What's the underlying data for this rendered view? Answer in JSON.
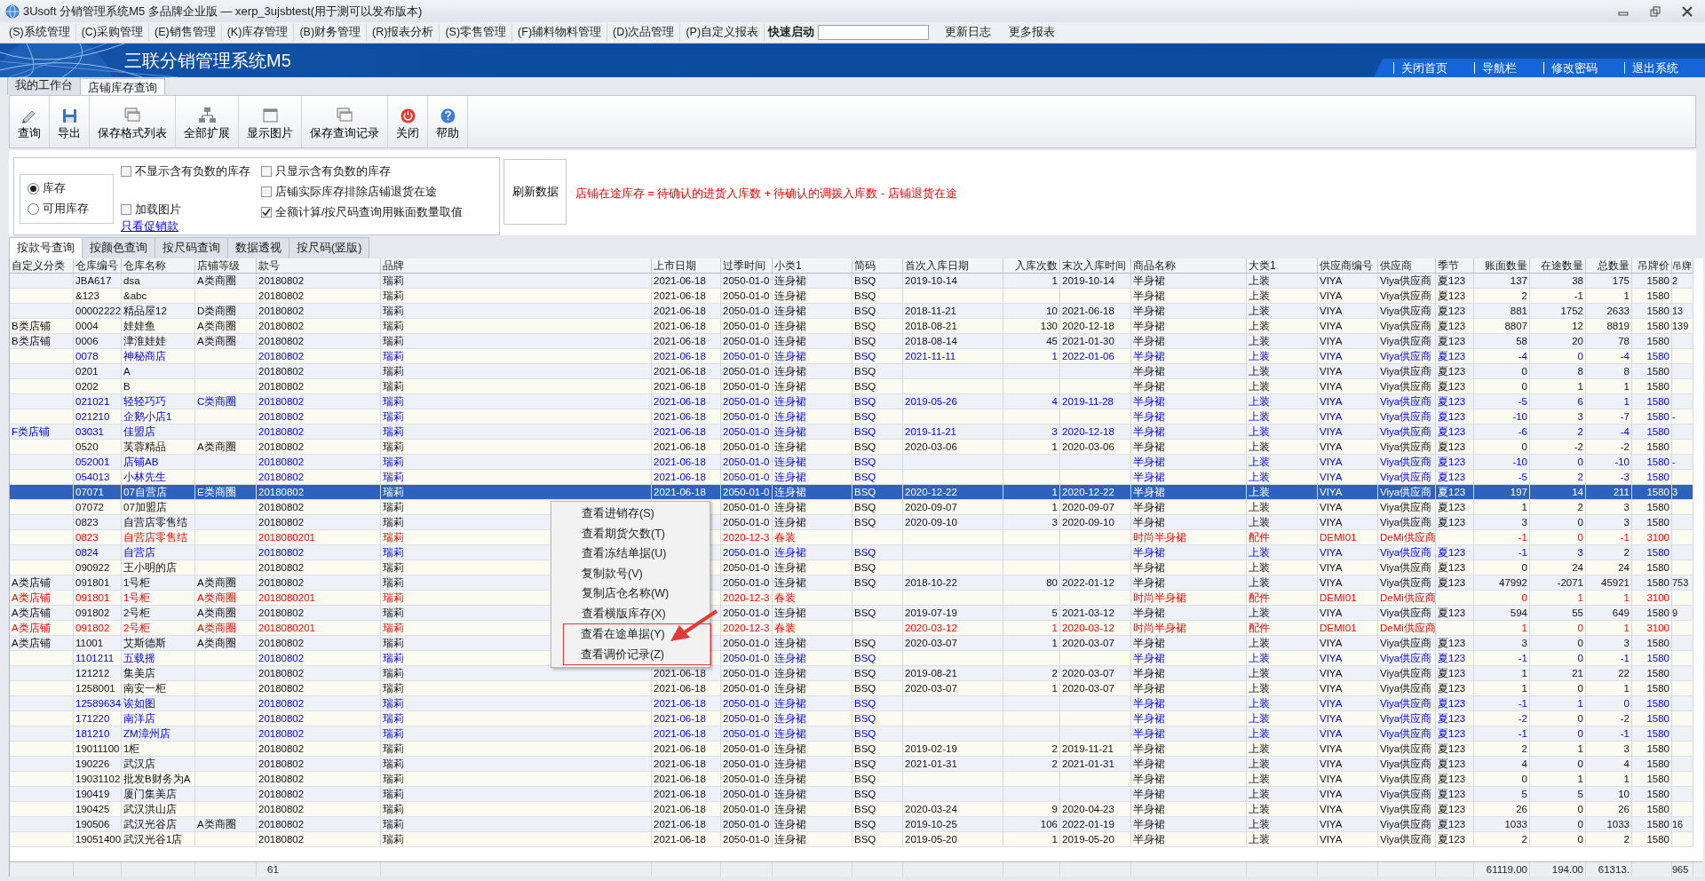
{
  "window": {
    "title": "3Usoft 分销管理系统M5 多品牌企业版 — xerp_3ujsbtest(用于测可以发布版本)"
  },
  "menu_bar": {
    "items": [
      "(S)系统管理",
      "(C)采购管理",
      "(E)销售管理",
      "(K)库存管理",
      "(B)财务管理",
      "(R)报表分析",
      "(S)零售管理",
      "(F)辅料物料管理",
      "(D)次品管理",
      "(P)自定义报表"
    ],
    "quick_launch": {
      "label": "快速启动"
    },
    "links": [
      "更新日志",
      "更多报表"
    ]
  },
  "banner": {
    "title": "三联分销管理系统M5",
    "links": [
      "关闭首页",
      "导航栏",
      "修改密码",
      "退出系统"
    ]
  },
  "tabs": [
    {
      "label": "我的工作台",
      "selected": false
    },
    {
      "label": "店铺库存查询",
      "selected": true
    }
  ],
  "toolbar": [
    {
      "label": "查询",
      "kind": "query"
    },
    {
      "label": "导出",
      "kind": "export"
    },
    {
      "label": "保存格式列表",
      "kind": "stack"
    },
    {
      "label": "全部扩展",
      "kind": "tree"
    },
    {
      "label": "显示图片",
      "kind": "window"
    },
    {
      "label": "保存查询记录",
      "kind": "stack"
    },
    {
      "label": "关闭",
      "kind": "close"
    },
    {
      "label": "帮助",
      "kind": "help"
    }
  ],
  "filters": {
    "stock_mode": [
      {
        "label": "库存",
        "selected": true
      },
      {
        "label": "可用库存",
        "selected": false
      }
    ],
    "checkbox_columns": [
      [
        {
          "label": "不显示含有负数的库存",
          "checked": false
        },
        {
          "label": "加载图片",
          "checked": false
        }
      ],
      [
        {
          "label": "只显示含有负数的库存",
          "checked": false
        },
        {
          "label": "店铺实际库存排除店铺退货在途",
          "checked": false
        },
        {
          "label": "全额计算/按尺码查询用账面数量取值",
          "checked": true
        }
      ]
    ],
    "link": "只看促销款",
    "refresh_button": "刷新数据",
    "note": "店铺在途库存 = 待确认的进货入库数 + 待确认的调拨入库数 - 店铺退货在途"
  },
  "query_tabs": [
    {
      "label": "按款号查询",
      "selected": true
    },
    {
      "label": "按颜色查询",
      "selected": false
    },
    {
      "label": "按尺码查询",
      "selected": false
    },
    {
      "label": "数据透视",
      "selected": false
    },
    {
      "label": "按尺码(竖版)",
      "selected": false
    }
  ],
  "table": {
    "columns": [
      "自定义分类",
      "仓库编号",
      "仓库名称",
      "店铺等级",
      "款号",
      "品牌",
      "上市日期",
      "过季时间",
      "小类1",
      "简码",
      "首次入库日期",
      "入库次数",
      "末次入库时间",
      "商品名称",
      "大类1",
      "供应商编号",
      "供应商",
      "季节",
      "账面数量",
      "在途数量",
      "总数量",
      "吊牌价",
      "吊牌"
    ],
    "rows": [
      {
        "kind": "plain",
        "selected": false,
        "cells": [
          null,
          "JBA617",
          "dsa",
          "A类商圈",
          "20180802",
          "瑞莉",
          "2021-06-18",
          "2050-01-0",
          "连身裙",
          "BSQ",
          "2019-10-14",
          "1",
          "2019-10-14",
          "半身裙",
          "上装",
          "VIYA",
          "Viya供应商",
          "夏123",
          "137",
          "38",
          "175",
          "1580",
          "2"
        ]
      },
      {
        "kind": "plain",
        "selected": false,
        "cells": [
          null,
          "&123",
          "&abc",
          null,
          "20180802",
          "瑞莉",
          "2021-06-18",
          "2050-01-0",
          "连身裙",
          "BSQ",
          null,
          null,
          null,
          "半身裙",
          "上装",
          "VIYA",
          "Viya供应商",
          "夏123",
          "2",
          "-1",
          "1",
          "1580",
          null
        ]
      },
      {
        "kind": "plain",
        "selected": false,
        "cells": [
          null,
          "00002222",
          "精品屋12",
          "D类商圈",
          "20180802",
          "瑞莉",
          "2021-06-18",
          "2050-01-0",
          "连身裙",
          "BSQ",
          "2018-11-21",
          "10",
          "2021-06-18",
          "半身裙",
          "上装",
          "VIYA",
          "Viya供应商",
          "夏123",
          "881",
          "1752",
          "2633",
          "1580",
          "13"
        ]
      },
      {
        "kind": "plain",
        "selected": false,
        "cells": [
          "B类店铺",
          "0004",
          "娃娃鱼",
          "A类商圈",
          "20180802",
          "瑞莉",
          "2021-06-18",
          "2050-01-0",
          "连身裙",
          "BSQ",
          "2018-08-21",
          "130",
          "2020-12-18",
          "半身裙",
          "上装",
          "VIYA",
          "Viya供应商",
          "夏123",
          "8807",
          "12",
          "8819",
          "1580",
          "139"
        ]
      },
      {
        "kind": "plain",
        "selected": false,
        "cells": [
          "B类店铺",
          "0006",
          "津淮娃娃",
          "A类商圈",
          "20180802",
          "瑞莉",
          "2021-06-18",
          "2050-01-0",
          "连身裙",
          "BSQ",
          "2018-08-14",
          "45",
          "2021-01-30",
          "半身裙",
          "上装",
          "VIYA",
          "Viya供应商",
          "夏123",
          "58",
          "20",
          "78",
          "1580",
          null
        ]
      },
      {
        "kind": "blue",
        "selected": false,
        "cells": [
          null,
          "0078",
          "神秘商店",
          null,
          "20180802",
          "瑞莉",
          "2021-06-18",
          "2050-01-0",
          "连身裙",
          "BSQ",
          "2021-11-11",
          "1",
          "2022-01-06",
          "半身裙",
          "上装",
          "VIYA",
          "Viya供应商",
          "夏123",
          "-4",
          "0",
          "-4",
          "1580",
          null
        ]
      },
      {
        "kind": "plain",
        "selected": false,
        "cells": [
          null,
          "0201",
          "A",
          null,
          "20180802",
          "瑞莉",
          "2021-06-18",
          "2050-01-0",
          "连身裙",
          "BSQ",
          null,
          null,
          null,
          "半身裙",
          "上装",
          "VIYA",
          "Viya供应商",
          "夏123",
          "0",
          "8",
          "8",
          "1580",
          null
        ]
      },
      {
        "kind": "plain",
        "selected": false,
        "cells": [
          null,
          "0202",
          "B",
          null,
          "20180802",
          "瑞莉",
          "2021-06-18",
          "2050-01-0",
          "连身裙",
          "BSQ",
          null,
          null,
          null,
          "半身裙",
          "上装",
          "VIYA",
          "Viya供应商",
          "夏123",
          "0",
          "1",
          "1",
          "1580",
          null
        ]
      },
      {
        "kind": "blue",
        "selected": false,
        "cells": [
          null,
          "021021",
          "轻轻巧巧",
          "C类商圈",
          "20180802",
          "瑞莉",
          "2021-06-18",
          "2050-01-0",
          "连身裙",
          "BSQ",
          "2019-05-26",
          "4",
          "2019-11-28",
          "半身裙",
          "上装",
          "VIYA",
          "Viya供应商",
          "夏123",
          "-5",
          "6",
          "1",
          "1580",
          null
        ]
      },
      {
        "kind": "blue",
        "selected": false,
        "cells": [
          null,
          "021210",
          "企鹅小店1",
          null,
          "20180802",
          "瑞莉",
          "2021-06-18",
          "2050-01-0",
          "连身裙",
          "BSQ",
          null,
          null,
          null,
          "半身裙",
          "上装",
          "VIYA",
          "Viya供应商",
          "夏123",
          "-10",
          "3",
          "-7",
          "1580",
          "-"
        ]
      },
      {
        "kind": "blue",
        "selected": false,
        "cells": [
          "F类店铺",
          "03031",
          "佳盟店",
          null,
          "20180802",
          "瑞莉",
          "2021-06-18",
          "2050-01-0",
          "连身裙",
          "BSQ",
          "2019-11-21",
          "3",
          "2020-12-18",
          "半身裙",
          "上装",
          "VIYA",
          "Viya供应商",
          "夏123",
          "-6",
          "2",
          "-4",
          "1580",
          null
        ]
      },
      {
        "kind": "plain",
        "selected": false,
        "cells": [
          null,
          "0520",
          "芙蓉精品",
          "A类商圈",
          "20180802",
          "瑞莉",
          "2021-06-18",
          "2050-01-0",
          "连身裙",
          "BSQ",
          "2020-03-06",
          "1",
          "2020-03-06",
          "半身裙",
          "上装",
          "VIYA",
          "Viya供应商",
          "夏123",
          "0",
          "-2",
          "-2",
          "1580",
          null
        ]
      },
      {
        "kind": "blue",
        "selected": false,
        "cells": [
          null,
          "052001",
          "店铺AB",
          null,
          "20180802",
          "瑞莉",
          "2021-06-18",
          "2050-01-0",
          "连身裙",
          "BSQ",
          null,
          null,
          null,
          "半身裙",
          "上装",
          "VIYA",
          "Viya供应商",
          "夏123",
          "-10",
          "0",
          "-10",
          "1580",
          "-"
        ]
      },
      {
        "kind": "blue",
        "selected": false,
        "cells": [
          null,
          "054013",
          "小林先生",
          null,
          "20180802",
          "瑞莉",
          "2021-06-18",
          "2050-01-0",
          "连身裙",
          "BSQ",
          null,
          null,
          null,
          "半身裙",
          "上装",
          "VIYA",
          "Viya供应商",
          "夏123",
          "-5",
          "2",
          "-3",
          "1580",
          null
        ]
      },
      {
        "kind": "plain",
        "selected": true,
        "cells": [
          null,
          "07071",
          "07自营店",
          "E类商圈",
          "20180802",
          "瑞莉",
          "2021-06-18",
          "2050-01-0",
          "连身裙",
          "BSQ",
          "2020-12-22",
          "1",
          "2020-12-22",
          "半身裙",
          "上装",
          "VIYA",
          "Viya供应商",
          "夏123",
          "197",
          "14",
          "211",
          "1580",
          "3"
        ]
      },
      {
        "kind": "plain",
        "selected": false,
        "cells": [
          null,
          "07072",
          "07加盟店",
          null,
          "20180802",
          "瑞莉",
          null,
          "2050-01-0",
          "连身裙",
          "BSQ",
          "2020-09-07",
          "1",
          "2020-09-07",
          "半身裙",
          "上装",
          "VIYA",
          "Viya供应商",
          "夏123",
          "1",
          "2",
          "3",
          "1580",
          null
        ]
      },
      {
        "kind": "plain",
        "selected": false,
        "cells": [
          null,
          "0823",
          "自营店零售结",
          null,
          "20180802",
          "瑞莉",
          null,
          "2050-01-0",
          "连身裙",
          "BSQ",
          "2020-09-10",
          "3",
          "2020-09-10",
          "半身裙",
          "上装",
          "VIYA",
          "Viya供应商",
          "夏123",
          "3",
          "0",
          "3",
          "1580",
          null
        ]
      },
      {
        "kind": "red",
        "selected": false,
        "cells": [
          null,
          "0823",
          "自营店零售结",
          null,
          "2018080201",
          "瑞莉",
          null,
          "2020-12-3",
          "春装",
          null,
          null,
          null,
          null,
          "时尚半身裙",
          "配件",
          "DEMI01",
          "DeMi供应商",
          null,
          "-1",
          "0",
          "-1",
          "3100",
          null
        ]
      },
      {
        "kind": "blue",
        "selected": false,
        "cells": [
          null,
          "0824",
          "自营店",
          null,
          "20180802",
          "瑞莉",
          null,
          "2050-01-0",
          "连身裙",
          "BSQ",
          null,
          null,
          null,
          "半身裙",
          "上装",
          "VIYA",
          "Viya供应商",
          "夏123",
          "-1",
          "3",
          "2",
          "1580",
          null
        ]
      },
      {
        "kind": "plain",
        "selected": false,
        "cells": [
          null,
          "090922",
          "王小明的店",
          null,
          "20180802",
          "瑞莉",
          null,
          "2050-01-0",
          "连身裙",
          "BSQ",
          null,
          null,
          null,
          "半身裙",
          "上装",
          "VIYA",
          "Viya供应商",
          "夏123",
          "0",
          "24",
          "24",
          "1580",
          null
        ]
      },
      {
        "kind": "plain",
        "selected": false,
        "cells": [
          "A类店铺",
          "091801",
          "1号柜",
          "A类商圈",
          "20180802",
          "瑞莉",
          null,
          "2050-01-0",
          "连身裙",
          "BSQ",
          "2018-10-22",
          "80",
          "2022-01-12",
          "半身裙",
          "上装",
          "VIYA",
          "Viya供应商",
          "夏123",
          "47992",
          "-2071",
          "45921",
          "1580",
          "753"
        ]
      },
      {
        "kind": "red",
        "selected": false,
        "cells": [
          "A类店铺",
          "091801",
          "1号柜",
          "A类商圈",
          "2018080201",
          "瑞莉",
          null,
          "2020-12-3",
          "春装",
          null,
          null,
          null,
          null,
          "时尚半身裙",
          "配件",
          "DEMI01",
          "DeMi供应商",
          null,
          "0",
          "1",
          "1",
          "3100",
          null
        ]
      },
      {
        "kind": "plain",
        "selected": false,
        "cells": [
          "A类店铺",
          "091802",
          "2号柜",
          "A类商圈",
          "20180802",
          "瑞莉",
          null,
          "2050-01-0",
          "连身裙",
          "BSQ",
          "2019-07-19",
          "5",
          "2021-03-12",
          "半身裙",
          "上装",
          "VIYA",
          "Viya供应商",
          "夏123",
          "594",
          "55",
          "649",
          "1580",
          "9"
        ]
      },
      {
        "kind": "red",
        "selected": false,
        "cells": [
          "A类店铺",
          "091802",
          "2号柜",
          "A类商圈",
          "2018080201",
          "瑞莉",
          null,
          "2020-12-3",
          "春装",
          null,
          "2020-03-12",
          "1",
          "2020-03-12",
          "时尚半身裙",
          "配件",
          "DEMI01",
          "DeMi供应商",
          null,
          "1",
          "0",
          "1",
          "3100",
          null
        ]
      },
      {
        "kind": "plain",
        "selected": false,
        "cells": [
          "A类店铺",
          "11001",
          "艾斯德斯",
          "A类商圈",
          "20180802",
          "瑞莉",
          null,
          "2050-01-0",
          "连身裙",
          "BSQ",
          "2020-03-07",
          "1",
          "2020-03-07",
          "半身裙",
          "上装",
          "VIYA",
          "Viya供应商",
          "夏123",
          "3",
          "0",
          "3",
          "1580",
          null
        ]
      },
      {
        "kind": "blue",
        "selected": false,
        "cells": [
          null,
          "1101211",
          "五载摇",
          null,
          "20180802",
          "瑞莉",
          null,
          "2050-01-0",
          "连身裙",
          "BSQ",
          null,
          null,
          null,
          "半身裙",
          "上装",
          "VIYA",
          "Viya供应商",
          "夏123",
          "-1",
          "0",
          "-1",
          "1580",
          null
        ]
      },
      {
        "kind": "plain",
        "selected": false,
        "cells": [
          null,
          "121212",
          "集美店",
          null,
          "20180802",
          "瑞莉",
          "2021-06-18",
          "2050-01-0",
          "连身裙",
          "BSQ",
          "2019-08-21",
          "2",
          "2020-03-07",
          "半身裙",
          "上装",
          "VIYA",
          "Viya供应商",
          "夏123",
          "1",
          "21",
          "22",
          "1580",
          null
        ]
      },
      {
        "kind": "plain",
        "selected": false,
        "cells": [
          null,
          "1258001",
          "南安一柜",
          null,
          "20180802",
          "瑞莉",
          "2021-06-18",
          "2050-01-0",
          "连身裙",
          "BSQ",
          "2020-03-07",
          "1",
          "2020-03-07",
          "半身裙",
          "上装",
          "VIYA",
          "Viya供应商",
          "夏123",
          "1",
          "0",
          "1",
          "1580",
          null
        ]
      },
      {
        "kind": "blue",
        "selected": false,
        "cells": [
          null,
          "12589634",
          "诶如图",
          null,
          "20180802",
          "瑞莉",
          "2021-06-18",
          "2050-01-0",
          "连身裙",
          "BSQ",
          null,
          null,
          null,
          "半身裙",
          "上装",
          "VIYA",
          "Viya供应商",
          "夏123",
          "-1",
          "1",
          "0",
          "1580",
          null
        ]
      },
      {
        "kind": "blue",
        "selected": false,
        "cells": [
          null,
          "171220",
          "南洋店",
          null,
          "20180802",
          "瑞莉",
          "2021-06-18",
          "2050-01-0",
          "连身裙",
          "BSQ",
          null,
          null,
          null,
          "半身裙",
          "上装",
          "VIYA",
          "Viya供应商",
          "夏123",
          "-2",
          "0",
          "-2",
          "1580",
          null
        ]
      },
      {
        "kind": "blue",
        "selected": false,
        "cells": [
          null,
          "181210",
          "ZM漳州店",
          null,
          "20180802",
          "瑞莉",
          "2021-06-18",
          "2050-01-0",
          "连身裙",
          "BSQ",
          null,
          null,
          null,
          "半身裙",
          "上装",
          "VIYA",
          "Viya供应商",
          "夏123",
          "-1",
          "0",
          "-1",
          "1580",
          null
        ]
      },
      {
        "kind": "plain",
        "selected": false,
        "cells": [
          null,
          "19011100",
          "1柜",
          null,
          "20180802",
          "瑞莉",
          "2021-06-18",
          "2050-01-0",
          "连身裙",
          "BSQ",
          "2019-02-19",
          "2",
          "2019-11-21",
          "半身裙",
          "上装",
          "VIYA",
          "Viya供应商",
          "夏123",
          "2",
          "1",
          "3",
          "1580",
          null
        ]
      },
      {
        "kind": "plain",
        "selected": false,
        "cells": [
          null,
          "190226",
          "武汉店",
          null,
          "20180802",
          "瑞莉",
          "2021-06-18",
          "2050-01-0",
          "连身裙",
          "BSQ",
          "2021-01-31",
          "2",
          "2021-01-31",
          "半身裙",
          "上装",
          "VIYA",
          "Viya供应商",
          "夏123",
          "4",
          "0",
          "4",
          "1580",
          null
        ]
      },
      {
        "kind": "plain",
        "selected": false,
        "cells": [
          null,
          "19031102",
          "批发B财务为A",
          null,
          "20180802",
          "瑞莉",
          "2021-06-18",
          "2050-01-0",
          "连身裙",
          "BSQ",
          null,
          null,
          null,
          "半身裙",
          "上装",
          "VIYA",
          "Viya供应商",
          "夏123",
          "0",
          "1",
          "1",
          "1580",
          null
        ]
      },
      {
        "kind": "plain",
        "selected": false,
        "cells": [
          null,
          "190419",
          "厦门集美店",
          null,
          "20180802",
          "瑞莉",
          "2021-06-18",
          "2050-01-0",
          "连身裙",
          "BSQ",
          null,
          null,
          null,
          "半身裙",
          "上装",
          "VIYA",
          "Viya供应商",
          "夏123",
          "5",
          "5",
          "10",
          "1580",
          null
        ]
      },
      {
        "kind": "plain",
        "selected": false,
        "cells": [
          null,
          "190425",
          "武汉洪山店",
          null,
          "20180802",
          "瑞莉",
          "2021-06-18",
          "2050-01-0",
          "连身裙",
          "BSQ",
          "2020-03-24",
          "9",
          "2020-04-23",
          "半身裙",
          "上装",
          "VIYA",
          "Viya供应商",
          "夏123",
          "26",
          "0",
          "26",
          "1580",
          null
        ]
      },
      {
        "kind": "plain",
        "selected": false,
        "cells": [
          null,
          "190506",
          "武汉光谷店",
          "A类商圈",
          "20180802",
          "瑞莉",
          "2021-06-18",
          "2050-01-0",
          "连身裙",
          "BSQ",
          "2019-10-25",
          "106",
          "2022-01-19",
          "半身裙",
          "上装",
          "VIYA",
          "Viya供应商",
          "夏123",
          "1033",
          "0",
          "1033",
          "1580",
          "16"
        ]
      },
      {
        "kind": "plain",
        "selected": false,
        "cells": [
          null,
          "19051400",
          "武汉光谷1店",
          null,
          "20180802",
          "瑞莉",
          "2021-06-18",
          "2050-01-0",
          "连身裙",
          "BSQ",
          "2019-05-20",
          "1",
          "2019-05-20",
          "半身裙",
          "上装",
          "VIYA",
          "Viya供应商",
          "夏123",
          "2",
          "0",
          "2",
          "1580",
          null
        ]
      }
    ],
    "totals": {
      "row_count": "61",
      "book_quantity": "61119.00",
      "transit_quantity": "194.00",
      "total_quantity": "61313.",
      "column_23": "965"
    }
  },
  "context_menu": {
    "items": [
      {
        "label": "查看进销存(S)",
        "highlighted": false
      },
      {
        "label": "查看期货欠数(T)",
        "highlighted": false
      },
      {
        "label": "查看冻结单据(U)",
        "highlighted": false
      },
      {
        "label": "复制款号(V)",
        "highlighted": false
      },
      {
        "label": "复制店仓名称(W)",
        "highlighted": false
      },
      {
        "label": "查看横版库存(X)",
        "highlighted": false
      },
      {
        "label": "查看在途单据(Y)",
        "highlighted": true
      },
      {
        "label": "查看调价记录(Z)",
        "highlighted": true
      }
    ]
  }
}
